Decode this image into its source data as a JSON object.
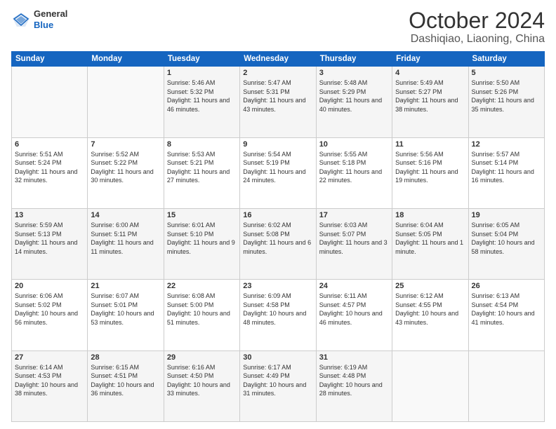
{
  "logo": {
    "general": "General",
    "blue": "Blue"
  },
  "header": {
    "month": "October 2024",
    "location": "Dashiqiao, Liaoning, China"
  },
  "weekdays": [
    "Sunday",
    "Monday",
    "Tuesday",
    "Wednesday",
    "Thursday",
    "Friday",
    "Saturday"
  ],
  "weeks": [
    [
      {
        "day": "",
        "sunrise": "",
        "sunset": "",
        "daylight": ""
      },
      {
        "day": "",
        "sunrise": "",
        "sunset": "",
        "daylight": ""
      },
      {
        "day": "1",
        "sunrise": "Sunrise: 5:46 AM",
        "sunset": "Sunset: 5:32 PM",
        "daylight": "Daylight: 11 hours and 46 minutes."
      },
      {
        "day": "2",
        "sunrise": "Sunrise: 5:47 AM",
        "sunset": "Sunset: 5:31 PM",
        "daylight": "Daylight: 11 hours and 43 minutes."
      },
      {
        "day": "3",
        "sunrise": "Sunrise: 5:48 AM",
        "sunset": "Sunset: 5:29 PM",
        "daylight": "Daylight: 11 hours and 40 minutes."
      },
      {
        "day": "4",
        "sunrise": "Sunrise: 5:49 AM",
        "sunset": "Sunset: 5:27 PM",
        "daylight": "Daylight: 11 hours and 38 minutes."
      },
      {
        "day": "5",
        "sunrise": "Sunrise: 5:50 AM",
        "sunset": "Sunset: 5:26 PM",
        "daylight": "Daylight: 11 hours and 35 minutes."
      }
    ],
    [
      {
        "day": "6",
        "sunrise": "Sunrise: 5:51 AM",
        "sunset": "Sunset: 5:24 PM",
        "daylight": "Daylight: 11 hours and 32 minutes."
      },
      {
        "day": "7",
        "sunrise": "Sunrise: 5:52 AM",
        "sunset": "Sunset: 5:22 PM",
        "daylight": "Daylight: 11 hours and 30 minutes."
      },
      {
        "day": "8",
        "sunrise": "Sunrise: 5:53 AM",
        "sunset": "Sunset: 5:21 PM",
        "daylight": "Daylight: 11 hours and 27 minutes."
      },
      {
        "day": "9",
        "sunrise": "Sunrise: 5:54 AM",
        "sunset": "Sunset: 5:19 PM",
        "daylight": "Daylight: 11 hours and 24 minutes."
      },
      {
        "day": "10",
        "sunrise": "Sunrise: 5:55 AM",
        "sunset": "Sunset: 5:18 PM",
        "daylight": "Daylight: 11 hours and 22 minutes."
      },
      {
        "day": "11",
        "sunrise": "Sunrise: 5:56 AM",
        "sunset": "Sunset: 5:16 PM",
        "daylight": "Daylight: 11 hours and 19 minutes."
      },
      {
        "day": "12",
        "sunrise": "Sunrise: 5:57 AM",
        "sunset": "Sunset: 5:14 PM",
        "daylight": "Daylight: 11 hours and 16 minutes."
      }
    ],
    [
      {
        "day": "13",
        "sunrise": "Sunrise: 5:59 AM",
        "sunset": "Sunset: 5:13 PM",
        "daylight": "Daylight: 11 hours and 14 minutes."
      },
      {
        "day": "14",
        "sunrise": "Sunrise: 6:00 AM",
        "sunset": "Sunset: 5:11 PM",
        "daylight": "Daylight: 11 hours and 11 minutes."
      },
      {
        "day": "15",
        "sunrise": "Sunrise: 6:01 AM",
        "sunset": "Sunset: 5:10 PM",
        "daylight": "Daylight: 11 hours and 9 minutes."
      },
      {
        "day": "16",
        "sunrise": "Sunrise: 6:02 AM",
        "sunset": "Sunset: 5:08 PM",
        "daylight": "Daylight: 11 hours and 6 minutes."
      },
      {
        "day": "17",
        "sunrise": "Sunrise: 6:03 AM",
        "sunset": "Sunset: 5:07 PM",
        "daylight": "Daylight: 11 hours and 3 minutes."
      },
      {
        "day": "18",
        "sunrise": "Sunrise: 6:04 AM",
        "sunset": "Sunset: 5:05 PM",
        "daylight": "Daylight: 11 hours and 1 minute."
      },
      {
        "day": "19",
        "sunrise": "Sunrise: 6:05 AM",
        "sunset": "Sunset: 5:04 PM",
        "daylight": "Daylight: 10 hours and 58 minutes."
      }
    ],
    [
      {
        "day": "20",
        "sunrise": "Sunrise: 6:06 AM",
        "sunset": "Sunset: 5:02 PM",
        "daylight": "Daylight: 10 hours and 56 minutes."
      },
      {
        "day": "21",
        "sunrise": "Sunrise: 6:07 AM",
        "sunset": "Sunset: 5:01 PM",
        "daylight": "Daylight: 10 hours and 53 minutes."
      },
      {
        "day": "22",
        "sunrise": "Sunrise: 6:08 AM",
        "sunset": "Sunset: 5:00 PM",
        "daylight": "Daylight: 10 hours and 51 minutes."
      },
      {
        "day": "23",
        "sunrise": "Sunrise: 6:09 AM",
        "sunset": "Sunset: 4:58 PM",
        "daylight": "Daylight: 10 hours and 48 minutes."
      },
      {
        "day": "24",
        "sunrise": "Sunrise: 6:11 AM",
        "sunset": "Sunset: 4:57 PM",
        "daylight": "Daylight: 10 hours and 46 minutes."
      },
      {
        "day": "25",
        "sunrise": "Sunrise: 6:12 AM",
        "sunset": "Sunset: 4:55 PM",
        "daylight": "Daylight: 10 hours and 43 minutes."
      },
      {
        "day": "26",
        "sunrise": "Sunrise: 6:13 AM",
        "sunset": "Sunset: 4:54 PM",
        "daylight": "Daylight: 10 hours and 41 minutes."
      }
    ],
    [
      {
        "day": "27",
        "sunrise": "Sunrise: 6:14 AM",
        "sunset": "Sunset: 4:53 PM",
        "daylight": "Daylight: 10 hours and 38 minutes."
      },
      {
        "day": "28",
        "sunrise": "Sunrise: 6:15 AM",
        "sunset": "Sunset: 4:51 PM",
        "daylight": "Daylight: 10 hours and 36 minutes."
      },
      {
        "day": "29",
        "sunrise": "Sunrise: 6:16 AM",
        "sunset": "Sunset: 4:50 PM",
        "daylight": "Daylight: 10 hours and 33 minutes."
      },
      {
        "day": "30",
        "sunrise": "Sunrise: 6:17 AM",
        "sunset": "Sunset: 4:49 PM",
        "daylight": "Daylight: 10 hours and 31 minutes."
      },
      {
        "day": "31",
        "sunrise": "Sunrise: 6:19 AM",
        "sunset": "Sunset: 4:48 PM",
        "daylight": "Daylight: 10 hours and 28 minutes."
      },
      {
        "day": "",
        "sunrise": "",
        "sunset": "",
        "daylight": ""
      },
      {
        "day": "",
        "sunrise": "",
        "sunset": "",
        "daylight": ""
      }
    ]
  ]
}
